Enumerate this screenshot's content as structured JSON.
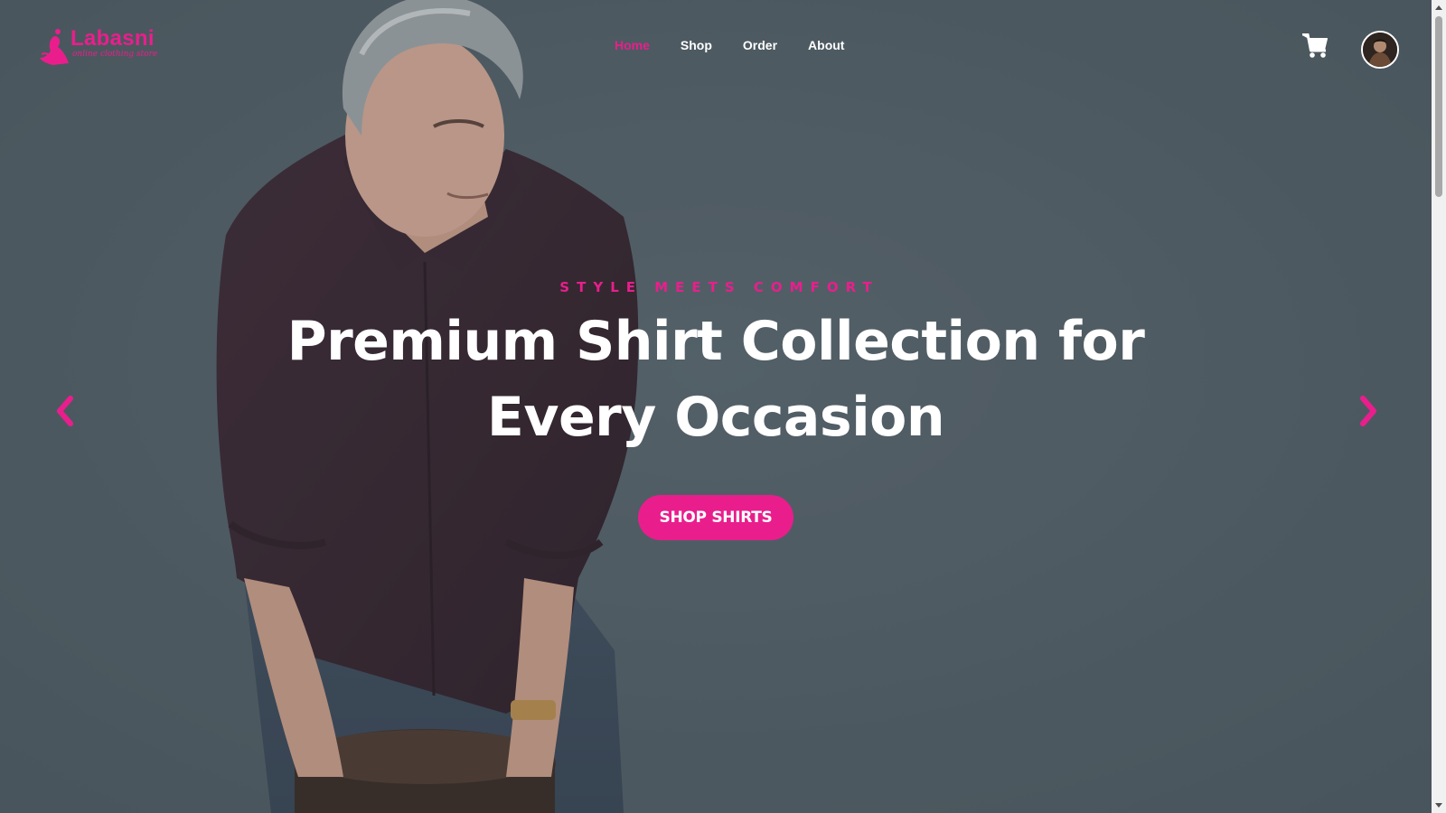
{
  "brand": {
    "name": "Labasni",
    "tagline": "online clothing store",
    "accent_color": "#e91e8c"
  },
  "nav": {
    "items": [
      {
        "label": "Home",
        "active": true
      },
      {
        "label": "Shop",
        "active": false
      },
      {
        "label": "Order",
        "active": false
      },
      {
        "label": "About",
        "active": false
      }
    ]
  },
  "header_icons": {
    "cart": "cart-icon",
    "avatar": "user-avatar"
  },
  "hero": {
    "eyebrow": "STYLE MEETS COMFORT",
    "headline": "Premium Shirt Collection for Every Occasion",
    "cta_label": "SHOP SHIRTS",
    "prev_icon": "chevron-left-icon",
    "next_icon": "chevron-right-icon"
  }
}
